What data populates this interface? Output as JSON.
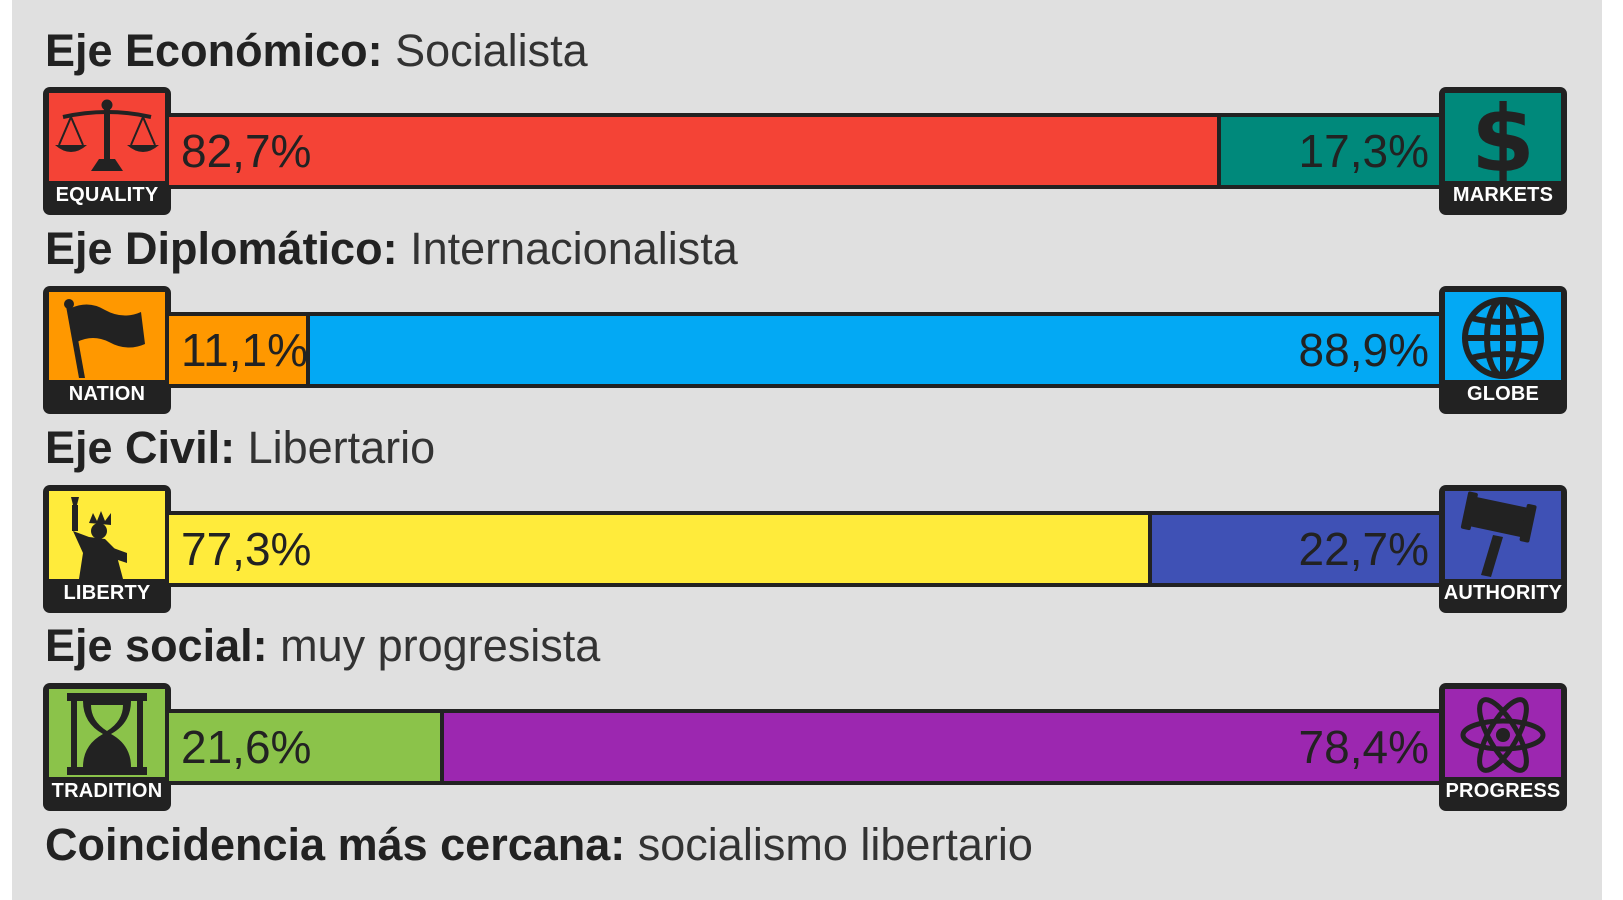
{
  "axes": [
    {
      "id": "economic",
      "label": "Eje Económico:",
      "value": "Socialista",
      "left": {
        "name": "EQUALITY",
        "percent": "82,7%",
        "fraction": 0.827,
        "color": "#f44336",
        "icon": "scales-icon"
      },
      "right": {
        "name": "MARKETS",
        "percent": "17,3%",
        "fraction": 0.173,
        "color": "#00897b",
        "icon": "dollar-icon"
      }
    },
    {
      "id": "diplomatic",
      "label": "Eje Diplomático:",
      "value": "Internacionalista",
      "left": {
        "name": "NATION",
        "percent": "11,1%",
        "fraction": 0.111,
        "color": "#ff9800",
        "icon": "flag-icon"
      },
      "right": {
        "name": "GLOBE",
        "percent": "88,9%",
        "fraction": 0.889,
        "color": "#03a9f4",
        "icon": "globe-icon"
      }
    },
    {
      "id": "civil",
      "label": "Eje Civil:",
      "value": "Libertario",
      "left": {
        "name": "LIBERTY",
        "percent": "77,3%",
        "fraction": 0.773,
        "color": "#ffeb3b",
        "icon": "statue-of-liberty-icon"
      },
      "right": {
        "name": "AUTHORITY",
        "percent": "22,7%",
        "fraction": 0.227,
        "color": "#3f51b5",
        "icon": "gavel-icon"
      }
    },
    {
      "id": "social",
      "label": "Eje social:",
      "value": "muy progresista",
      "left": {
        "name": "TRADITION",
        "percent": "21,6%",
        "fraction": 0.216,
        "color": "#8bc34a",
        "icon": "hourglass-icon"
      },
      "right": {
        "name": "PROGRESS",
        "percent": "78,4%",
        "fraction": 0.784,
        "color": "#9c27b0",
        "icon": "atom-icon"
      }
    }
  ],
  "closest_match": {
    "label": "Coincidencia más cercana:",
    "value": "socialismo libertario"
  }
}
